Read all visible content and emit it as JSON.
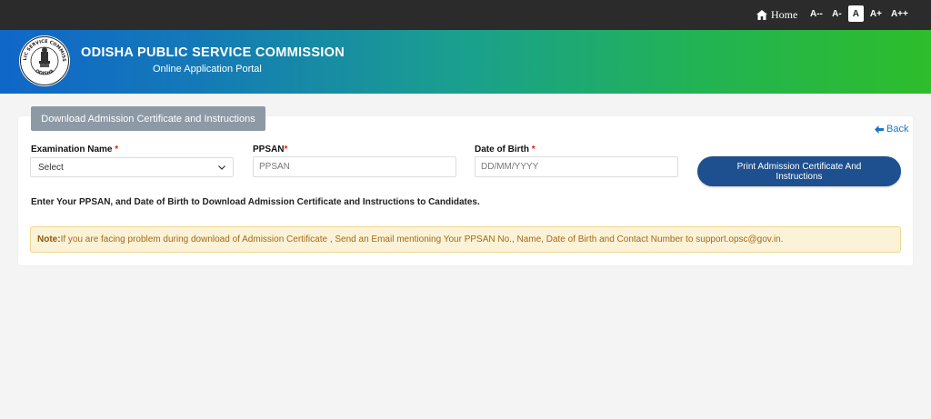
{
  "topbar": {
    "home_label": "Home",
    "font_sizes": [
      "A--",
      "A-",
      "A",
      "A+",
      "A++"
    ],
    "active_font": "A"
  },
  "header": {
    "title": "ODISHA PUBLIC SERVICE COMMISSION",
    "subtitle": "Online Application Portal",
    "logo_text": "PUBLIC SERVICE COMMISSION ODISHA",
    "colors": {
      "gradient_start": "#0f67c8",
      "gradient_end": "#2ebd2b"
    }
  },
  "form": {
    "tab_label": "Download Admission Certificate and Instructions",
    "back_label": "Back",
    "exam_label": "Examination Name",
    "exam_selected": "Select",
    "ppsan_label": "PPSAN",
    "ppsan_placeholder": "PPSAN",
    "dob_label": "Date of Birth",
    "dob_placeholder": "DD/MM/YYYY",
    "required_mark": "*",
    "print_button": "Print Admission Certificate And Instructions",
    "instruction": "Enter Your PPSAN, and Date of Birth to Download Admission Certificate and Instructions to Candidates.",
    "note_label": "Note:",
    "note_text": "If you are facing problem during download of Admission Certificate , Send an Email mentioning Your PPSAN No., Name, Date of Birth and Contact Number to support.opsc@gov.in.",
    "colors": {
      "button": "#1e4f8f",
      "tab": "#8d9aa6",
      "required": "#d9230f",
      "note_bg": "#fcf2d7"
    }
  }
}
